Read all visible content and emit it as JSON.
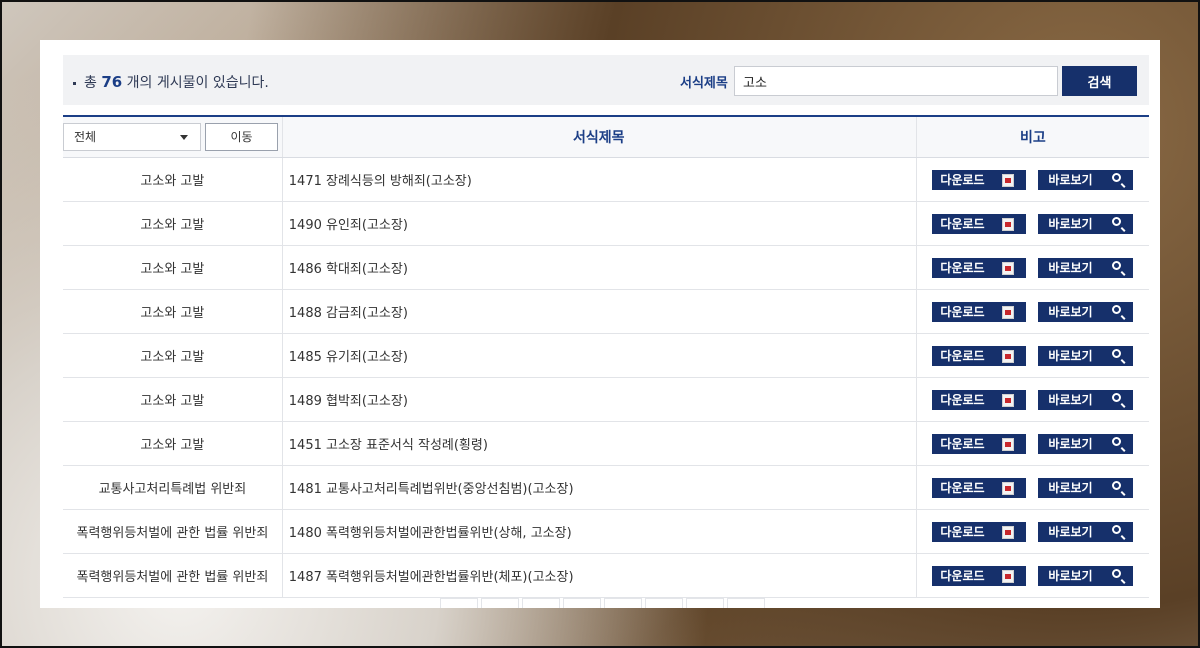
{
  "summary": {
    "prefix": "총",
    "count": "76",
    "suffix": "개의 게시물이 있습니다."
  },
  "search": {
    "label": "서식제목",
    "value": "고소",
    "button": "검색"
  },
  "filter": {
    "selected": "전체",
    "move_label": "이동"
  },
  "table": {
    "headers": [
      "서식제목",
      "비고"
    ],
    "download_label": "다운로드",
    "view_label": "바로보기",
    "rows": [
      {
        "category": "고소와 고발",
        "title": "1471 장례식등의 방해죄(고소장)"
      },
      {
        "category": "고소와 고발",
        "title": "1490 유인죄(고소장)"
      },
      {
        "category": "고소와 고발",
        "title": "1486 학대죄(고소장)"
      },
      {
        "category": "고소와 고발",
        "title": "1488 감금죄(고소장)"
      },
      {
        "category": "고소와 고발",
        "title": "1485 유기죄(고소장)"
      },
      {
        "category": "고소와 고발",
        "title": "1489 협박죄(고소장)"
      },
      {
        "category": "고소와 고발",
        "title": "1451 고소장 표준서식 작성례(횡령)"
      },
      {
        "category": "교통사고처리특례법 위반죄",
        "title": "1481 교통사고처리특례법위반(중앙선침범)(고소장)"
      },
      {
        "category": "폭력행위등처벌에 관한 법률 위반죄",
        "title": "1480 폭력행위등처벌에관한법률위반(상해, 고소장)"
      },
      {
        "category": "폭력행위등처벌에 관한 법률 위반죄",
        "title": "1487 폭력행위등처벌에관한법률위반(체포)(고소장)"
      }
    ]
  },
  "icons": {
    "download": "pdf-file-icon",
    "view": "magnifier-icon",
    "dropdown": "chevron-down-icon"
  },
  "colors": {
    "accent": "#16306b",
    "header_text": "#1b3e86",
    "bar_bg": "#f1f2f4"
  }
}
